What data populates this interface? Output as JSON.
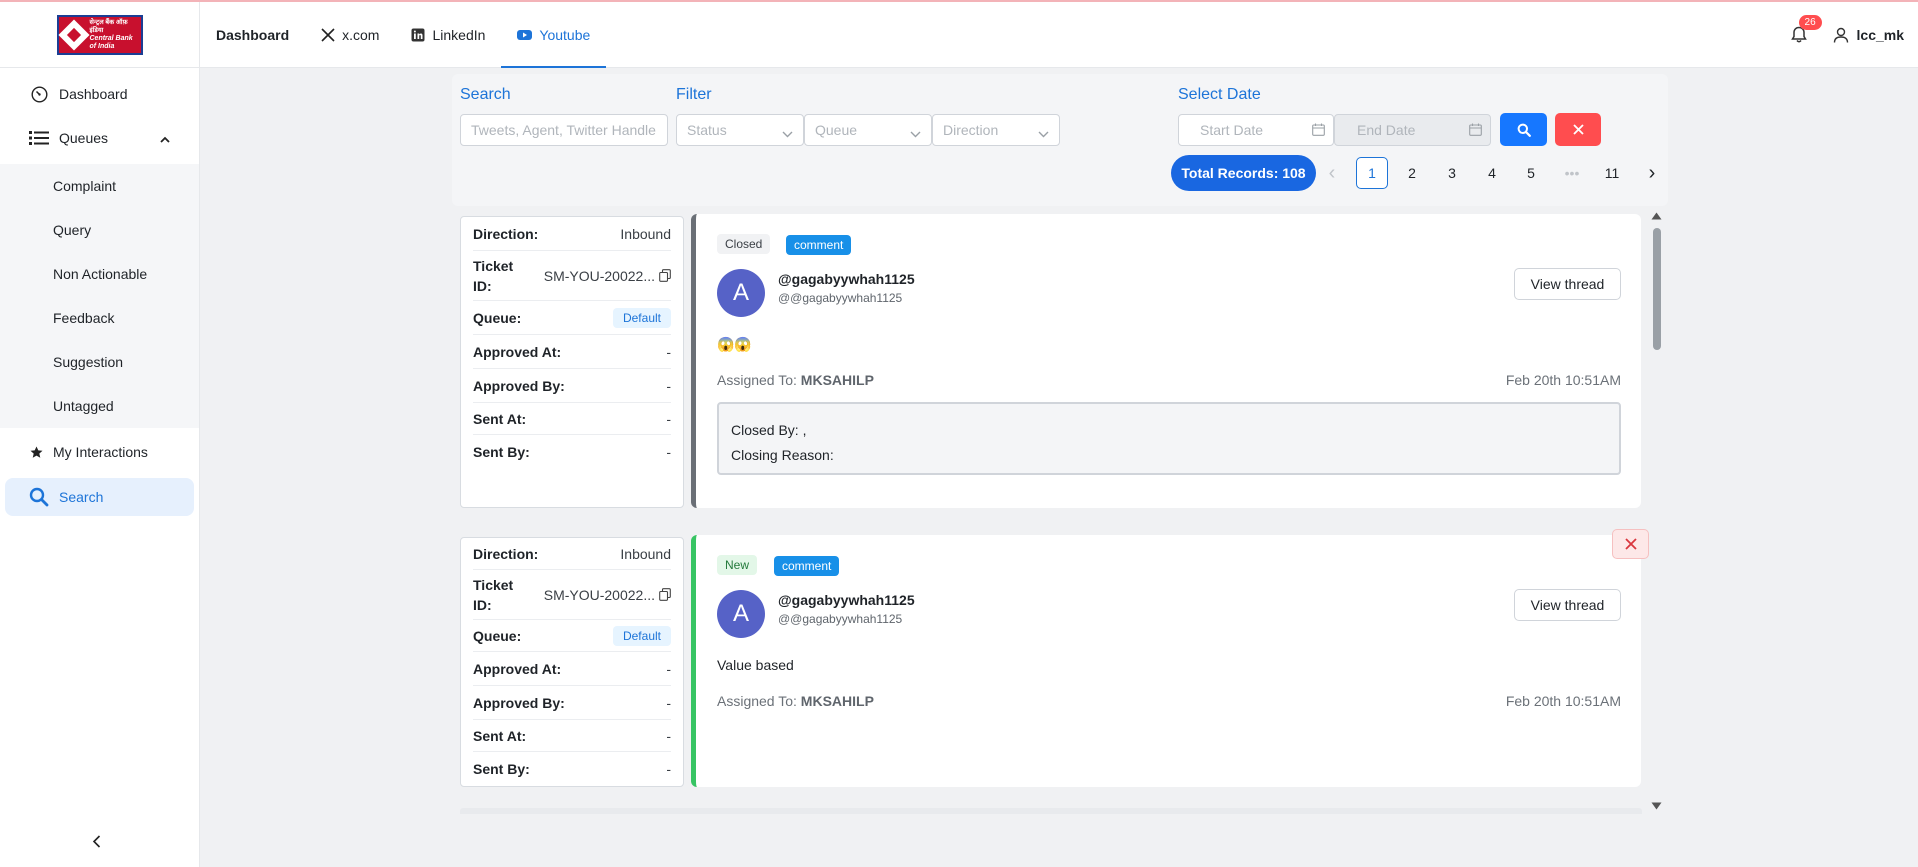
{
  "header": {
    "logo_hindi": "सेन्ट्रल बैंक ऑफ़ इंडिया",
    "logo_english": "Central Bank of India",
    "tabs": [
      {
        "label": "Dashboard"
      },
      {
        "label": "x.com"
      },
      {
        "label": "LinkedIn"
      },
      {
        "label": "Youtube"
      }
    ],
    "active_tab": "Youtube",
    "notification_count": "26",
    "username": "lcc_mk"
  },
  "sidebar": {
    "items": [
      {
        "label": "Dashboard",
        "icon": "gauge-icon"
      },
      {
        "label": "Queues",
        "icon": "list-icon"
      },
      {
        "label": "My Interactions",
        "icon": "star-icon"
      },
      {
        "label": "Search",
        "icon": "search-icon"
      }
    ],
    "queue_items": [
      "Complaint",
      "Query",
      "Non Actionable",
      "Feedback",
      "Suggestion",
      "Untagged"
    ],
    "active": "Search"
  },
  "filters": {
    "search_label": "Search",
    "search_placeholder": "Tweets, Agent, Twitter Handle",
    "filter_label": "Filter",
    "status_placeholder": "Status",
    "queue_placeholder": "Queue",
    "direction_placeholder": "Direction",
    "date_label": "Select Date",
    "start_date_placeholder": "Start Date",
    "end_date_placeholder": "End Date"
  },
  "pagination": {
    "total_label": "Total Records: 108",
    "pages": [
      "1",
      "2",
      "3",
      "4",
      "5",
      "•••",
      "11"
    ],
    "current": "1",
    "prev": "‹",
    "next": "›"
  },
  "records": [
    {
      "direction_label": "Direction:",
      "direction": "Inbound",
      "ticket_label": "Ticket ID:",
      "ticket_id": "SM-YOU-20022...",
      "queue_label": "Queue:",
      "queue": "Default",
      "approved_at_label": "Approved At:",
      "approved_at": "-",
      "approved_by_label": "Approved By:",
      "approved_by": "-",
      "sent_at_label": "Sent At:",
      "sent_at": "-",
      "sent_by_label": "Sent By:",
      "sent_by": "-",
      "status": "Closed",
      "type": "comment",
      "avatar_letter": "A",
      "handle": "@gagabyywhah1125",
      "subhandle": "@@gagabyywhah1125",
      "message": "😱😱",
      "assigned_label": "Assigned To:",
      "assigned_to": "MKSAHILP",
      "date": "Feb 20th 10:51AM",
      "closed_by": "Closed By: ,",
      "closing_reason": "Closing Reason:",
      "view_thread": "View thread"
    },
    {
      "direction_label": "Direction:",
      "direction": "Inbound",
      "ticket_label": "Ticket ID:",
      "ticket_id": "SM-YOU-20022...",
      "queue_label": "Queue:",
      "queue": "Default",
      "approved_at_label": "Approved At:",
      "approved_at": "-",
      "approved_by_label": "Approved By:",
      "approved_by": "-",
      "sent_at_label": "Sent At:",
      "sent_at": "-",
      "sent_by_label": "Sent By:",
      "sent_by": "-",
      "status": "New",
      "type": "comment",
      "avatar_letter": "A",
      "handle": "@gagabyywhah1125",
      "subhandle": "@@gagabyywhah1125",
      "message": "Value based",
      "assigned_label": "Assigned To:",
      "assigned_to": "MKSAHILP",
      "date": "Feb 20th 10:51AM",
      "view_thread": "View thread"
    }
  ],
  "colors": {
    "accent": "#1d74d8",
    "primary_button": "#1677ff",
    "danger": "#ff4d4f",
    "closed_border": "#6a6f76",
    "new_border": "#37c463"
  }
}
